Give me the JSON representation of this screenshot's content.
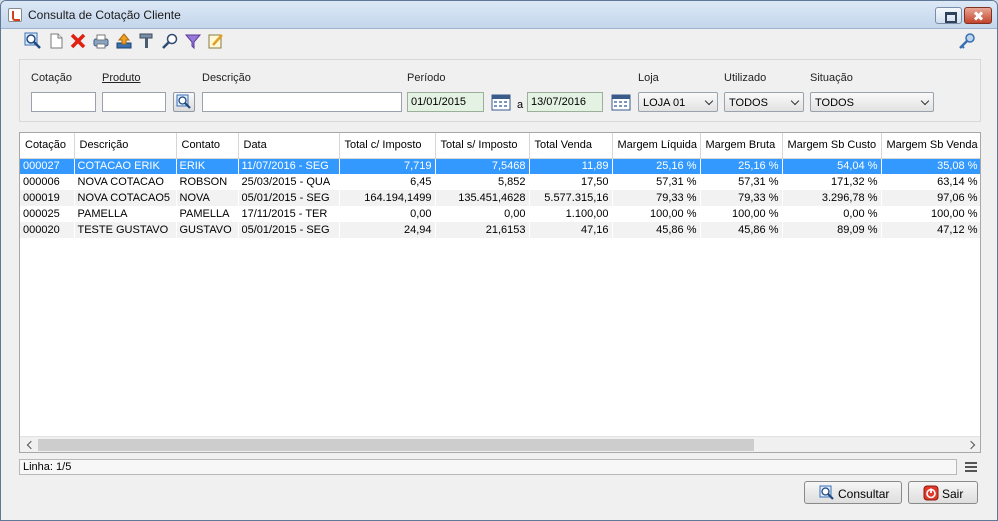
{
  "window": {
    "title": "Consulta de Cotação Cliente"
  },
  "toolbar": {
    "icons": [
      "search-icon",
      "new-document-icon",
      "delete-icon",
      "print-icon",
      "export-icon",
      "tools-icon",
      "edit-icon",
      "filter-icon",
      "notes-icon",
      "key-icon"
    ]
  },
  "filters": {
    "cotacao_label": "Cotação",
    "cotacao_value": "",
    "produto_label": "Produto",
    "produto_value": "",
    "descricao_label": "Descrição",
    "descricao_value": "",
    "periodo_label": "Período",
    "periodo_start": "01/01/2015",
    "periodo_sep": "a",
    "periodo_end": "13/07/2016",
    "loja_label": "Loja",
    "loja_value": "LOJA 01",
    "utilizado_label": "Utilizado",
    "utilizado_value": "TODOS",
    "situacao_label": "Situação",
    "situacao_value": "TODOS"
  },
  "table": {
    "columns": [
      "Cotação",
      "Descrição",
      "Contato",
      "Data",
      "Total c/ Imposto",
      "Total s/ Imposto",
      "Total Venda",
      "Margem Líquida",
      "Margem Bruta",
      "Margem Sb Custo",
      "Margem Sb Venda"
    ],
    "rows": [
      [
        "000027",
        "COTACAO ERIK",
        "ERIK",
        "11/07/2016 - SEG",
        "7,719",
        "7,5468",
        "11,89",
        "25,16 %",
        "25,16 %",
        "54,04 %",
        "35,08 %"
      ],
      [
        "000006",
        "NOVA COTACAO",
        "ROBSON",
        "25/03/2015 - QUA",
        "6,45",
        "5,852",
        "17,50",
        "57,31 %",
        "57,31 %",
        "171,32 %",
        "63,14 %"
      ],
      [
        "000019",
        "NOVA COTACAO5",
        "NOVA",
        "05/01/2015 - SEG",
        "164.194,1499",
        "135.451,4628",
        "5.577.315,16",
        "79,33 %",
        "79,33 %",
        "3.296,78 %",
        "97,06 %"
      ],
      [
        "000025",
        "PAMELLA",
        "PAMELLA",
        "17/11/2015 - TER",
        "0,00",
        "0,00",
        "1.100,00",
        "100,00 %",
        "100,00 %",
        "0,00 %",
        "100,00 %"
      ],
      [
        "000020",
        "TESTE GUSTAVO",
        "GUSTAVO",
        "05/01/2015 - SEG",
        "24,94",
        "21,6153",
        "47,16",
        "45,86 %",
        "45,86 %",
        "89,09 %",
        "47,12 %"
      ]
    ],
    "selected_row": 0
  },
  "status": {
    "linha": "Linha: 1/5"
  },
  "buttons": {
    "consultar": "Consultar",
    "sair": "Sair"
  },
  "colors": {
    "selection": "#3399ff",
    "date_field": "#e4f2e4"
  }
}
